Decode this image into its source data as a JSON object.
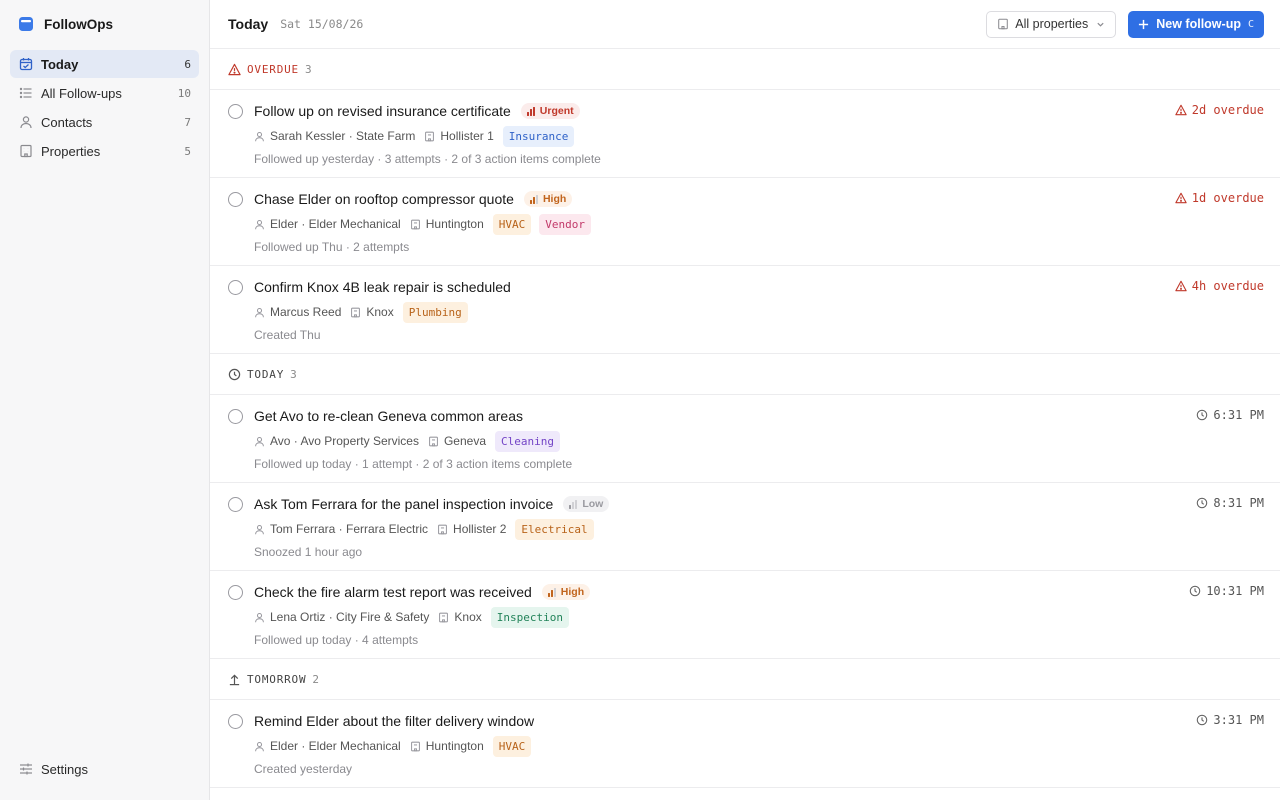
{
  "app": {
    "name": "FollowOps"
  },
  "sidebar": {
    "items": [
      {
        "label": "Today",
        "count": "6",
        "icon": "calendar-check-icon",
        "active": true
      },
      {
        "label": "All Follow-ups",
        "count": "10",
        "icon": "list-icon",
        "active": false
      },
      {
        "label": "Contacts",
        "count": "7",
        "icon": "person-icon",
        "active": false
      },
      {
        "label": "Properties",
        "count": "5",
        "icon": "building-icon",
        "active": false
      }
    ],
    "settings": {
      "label": "Settings",
      "icon": "sliders-icon"
    }
  },
  "header": {
    "title": "Today",
    "date": "Sat 15/08/26",
    "property_filter": "All properties",
    "new_button": "New follow-up",
    "new_button_shortcut": "C"
  },
  "colors": {
    "accent": "#2f6fe4",
    "overdue": "#c0392b",
    "urgent": "#c0392b",
    "high": "#c1641c",
    "low": "#9a9aa0"
  },
  "sections": [
    {
      "label": "OVERDUE",
      "count": "3",
      "icon": "warning-icon",
      "tasks": [
        {
          "title": "Follow up on revised insurance certificate",
          "priority": "Urgent",
          "contact": "Sarah Kessler · State Farm",
          "property": "Hollister 1",
          "tags": [
            "Insurance"
          ],
          "status": "Followed up yesterday · 3 attempts · 2 of 3 action items complete",
          "due": "2d overdue"
        },
        {
          "title": "Chase Elder on rooftop compressor quote",
          "priority": "High",
          "contact": "Elder · Elder Mechanical",
          "property": "Huntington",
          "tags": [
            "HVAC",
            "Vendor"
          ],
          "status": "Followed up Thu · 2 attempts",
          "due": "1d overdue"
        },
        {
          "title": "Confirm Knox 4B leak repair is scheduled",
          "priority": "",
          "contact": "Marcus Reed",
          "property": "Knox",
          "tags": [
            "Plumbing"
          ],
          "status": "Created Thu",
          "due": "4h overdue"
        }
      ]
    },
    {
      "label": "TODAY",
      "count": "3",
      "icon": "clock-icon",
      "tasks": [
        {
          "title": "Get Avo to re-clean Geneva common areas",
          "priority": "",
          "contact": "Avo · Avo Property Services",
          "property": "Geneva",
          "tags": [
            "Cleaning"
          ],
          "status": "Followed up today · 1 attempt · 2 of 3 action items complete",
          "due": "6:31 PM"
        },
        {
          "title": "Ask Tom Ferrara for the panel inspection invoice",
          "priority": "Low",
          "contact": "Tom Ferrara · Ferrara Electric",
          "property": "Hollister 2",
          "tags": [
            "Electrical"
          ],
          "status": "Snoozed 1 hour ago",
          "due": "8:31 PM"
        },
        {
          "title": "Check the fire alarm test report was received",
          "priority": "High",
          "contact": "Lena Ortiz · City Fire & Safety",
          "property": "Knox",
          "tags": [
            "Inspection"
          ],
          "status": "Followed up today · 4 attempts",
          "due": "10:31 PM"
        }
      ]
    },
    {
      "label": "TOMORROW",
      "count": "2",
      "icon": "arrow-up-icon",
      "tasks": [
        {
          "title": "Remind Elder about the filter delivery window",
          "priority": "",
          "contact": "Elder · Elder Mechanical",
          "property": "Huntington",
          "tags": [
            "HVAC"
          ],
          "status": "Created yesterday",
          "due": "3:31 PM"
        }
      ]
    }
  ]
}
